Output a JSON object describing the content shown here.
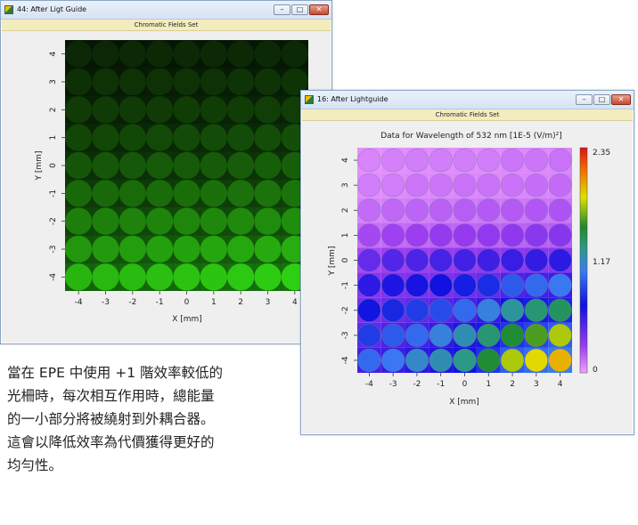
{
  "windows": [
    {
      "title": "44: After Ligt Guide",
      "subtitle": "Chromatic Fields Set",
      "controls": {
        "minimize": "–",
        "maximize": "□",
        "close": "✕"
      },
      "chart": {
        "xlabel": "X [mm]",
        "ylabel": "Y [mm]",
        "xticks": [
          "-4",
          "-3",
          "-2",
          "-1",
          "0",
          "1",
          "2",
          "3",
          "4"
        ],
        "yticks": [
          "4",
          "3",
          "2",
          "1",
          "0",
          "-1",
          "-2",
          "-3",
          "-4"
        ]
      }
    },
    {
      "title": "16: After Lightguide",
      "subtitle": "Chromatic Fields Set",
      "controls": {
        "minimize": "–",
        "maximize": "□",
        "close": "✕"
      },
      "chart": {
        "title": "Data for Wavelength of 532 nm  [1E-5 (V/m)²]",
        "xlabel": "X [mm]",
        "ylabel": "Y [mm]",
        "xticks": [
          "-4",
          "-3",
          "-2",
          "-1",
          "0",
          "1",
          "2",
          "3",
          "4"
        ],
        "yticks": [
          "4",
          "3",
          "2",
          "1",
          "0",
          "-1",
          "-2",
          "-3",
          "-4"
        ],
        "colorbar": {
          "max": "2.35",
          "mid": "1.17",
          "min": "0"
        }
      }
    }
  ],
  "caption": {
    "lines": [
      "當在 EPE 中使用 +1 階效率較低的",
      "光柵時，每次相互作用時，總能量",
      "的一小部分將被繞射到外耦合器。",
      "這會以降低效率為代價獲得更好的",
      "均勻性。"
    ]
  },
  "chart_data": [
    {
      "type": "heatmap",
      "title": "",
      "xlabel": "X [mm]",
      "ylabel": "Y [mm]",
      "xlim": [
        -4.5,
        4.5
      ],
      "ylim": [
        -4.5,
        4.5
      ],
      "grid_points": [
        -4,
        -3,
        -2,
        -1,
        0,
        1,
        2,
        3,
        4
      ],
      "colormap": "green",
      "row_intensity_top_to_bottom": [
        0.05,
        0.1,
        0.15,
        0.22,
        0.3,
        0.4,
        0.52,
        0.66,
        0.82
      ]
    },
    {
      "type": "heatmap",
      "title": "Data for Wavelength of 532 nm  [1E-5 (V/m)²]",
      "xlabel": "X [mm]",
      "ylabel": "Y [mm]",
      "xlim": [
        -4.5,
        4.5
      ],
      "ylim": [
        -4.5,
        4.5
      ],
      "colorbar_range": [
        0,
        2.35
      ],
      "colormap": "violet-blue-cyan-green-yellow-red",
      "columns_x": [
        -4,
        -3,
        -2,
        -1,
        0,
        1,
        2,
        3,
        4
      ],
      "rows_y_top_to_bottom": [
        4,
        3,
        2,
        1,
        0,
        -1,
        -2,
        -3,
        -4
      ],
      "values": [
        [
          0.08,
          0.09,
          0.1,
          0.1,
          0.1,
          0.1,
          0.12,
          0.12,
          0.13
        ],
        [
          0.1,
          0.1,
          0.12,
          0.12,
          0.13,
          0.13,
          0.13,
          0.14,
          0.15
        ],
        [
          0.15,
          0.16,
          0.17,
          0.18,
          0.19,
          0.2,
          0.2,
          0.21,
          0.22
        ],
        [
          0.25,
          0.27,
          0.28,
          0.3,
          0.3,
          0.31,
          0.32,
          0.33,
          0.34
        ],
        [
          0.45,
          0.5,
          0.52,
          0.54,
          0.55,
          0.56,
          0.58,
          0.6,
          0.62
        ],
        [
          0.62,
          0.66,
          0.68,
          0.7,
          0.75,
          0.8,
          0.95,
          1.0,
          1.05
        ],
        [
          0.72,
          0.78,
          0.85,
          0.9,
          1.0,
          1.1,
          1.25,
          1.35,
          1.4
        ],
        [
          0.85,
          0.95,
          1.0,
          1.1,
          1.2,
          1.35,
          1.5,
          1.6,
          1.75
        ],
        [
          1.0,
          1.05,
          1.15,
          1.2,
          1.3,
          1.5,
          1.75,
          1.85,
          1.95
        ]
      ]
    }
  ]
}
